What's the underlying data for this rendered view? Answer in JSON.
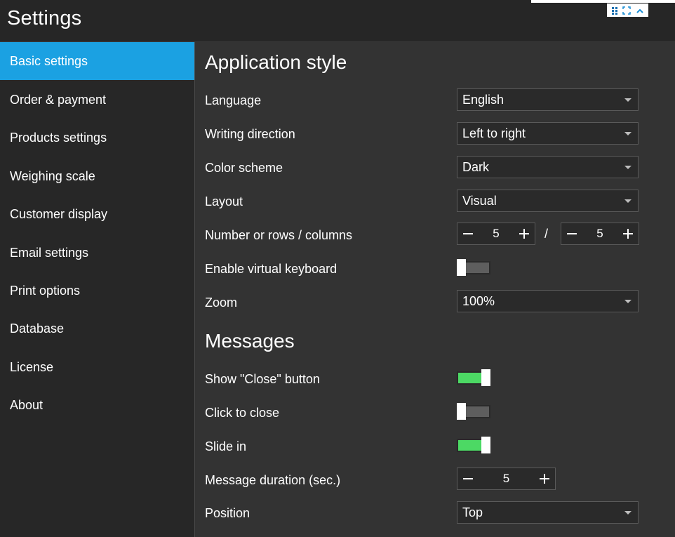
{
  "window": {
    "title": "Settings"
  },
  "sidebar": {
    "items": [
      {
        "label": "Basic settings",
        "active": true
      },
      {
        "label": "Order & payment"
      },
      {
        "label": "Products settings"
      },
      {
        "label": "Weighing scale"
      },
      {
        "label": "Customer display"
      },
      {
        "label": "Email settings"
      },
      {
        "label": "Print options"
      },
      {
        "label": "Database"
      },
      {
        "label": "License"
      },
      {
        "label": "About"
      }
    ]
  },
  "application_style": {
    "title": "Application style",
    "language": {
      "label": "Language",
      "value": "English"
    },
    "writing_direction": {
      "label": "Writing direction",
      "value": "Left to right"
    },
    "color_scheme": {
      "label": "Color scheme",
      "value": "Dark"
    },
    "layout": {
      "label": "Layout",
      "value": "Visual"
    },
    "rows_columns": {
      "label": "Number or rows / columns",
      "rows": "5",
      "separator": "/",
      "columns": "5"
    },
    "virtual_keyboard": {
      "label": "Enable virtual keyboard",
      "enabled": false
    },
    "zoom": {
      "label": "Zoom",
      "value": "100%"
    }
  },
  "messages": {
    "title": "Messages",
    "show_close_button": {
      "label": "Show \"Close\" button",
      "enabled": true
    },
    "click_to_close": {
      "label": "Click to close",
      "enabled": false
    },
    "slide_in": {
      "label": "Slide in",
      "enabled": true
    },
    "message_duration": {
      "label": "Message duration (sec.)",
      "value": "5"
    },
    "position": {
      "label": "Position",
      "value": "Top"
    }
  },
  "colors": {
    "accent": "#1ba1e2",
    "toggle_on": "#4cd964",
    "toggle_off": "#5e5e5e",
    "background": "#333333",
    "sidebar": "#272727"
  },
  "icons": {
    "decrement": "minus-icon",
    "increment": "plus-icon",
    "dropdown": "caret-down-icon",
    "drag": "drag-handle-icon",
    "fullscreen": "fullscreen-icon",
    "collapse": "chevron-up-icon"
  }
}
